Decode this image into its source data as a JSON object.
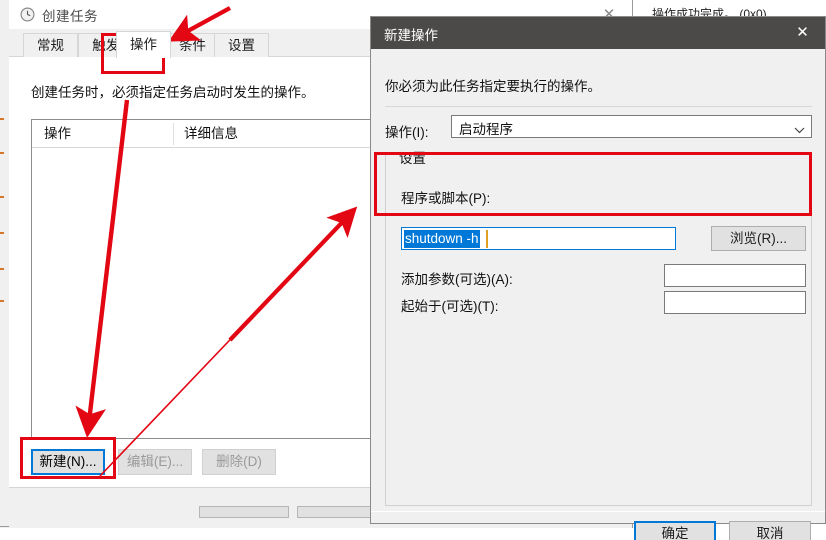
{
  "background_window": {
    "status_code": "0",
    "status_message": "操作成功完成。 (0x0)"
  },
  "main_window": {
    "title": "创建任务",
    "title_icon": "clock-icon",
    "close_label": "✕",
    "tabs": [
      {
        "label": "常规",
        "active": false
      },
      {
        "label": "触发器",
        "active": false
      },
      {
        "label": "操作",
        "active": true
      },
      {
        "label": "条件",
        "active": false
      },
      {
        "label": "设置",
        "active": false
      }
    ],
    "description": "创建任务时，必须指定任务启动时发生的操作。",
    "listview": {
      "columns": [
        "操作",
        "详细信息"
      ],
      "rows": []
    },
    "buttons": [
      {
        "label": "新建(N)...",
        "state": "focused"
      },
      {
        "label": "编辑(E)...",
        "state": "disabled"
      },
      {
        "label": "删除(D)",
        "state": "disabled"
      }
    ]
  },
  "dialog": {
    "title": "新建操作",
    "close_label": "✕",
    "description": "你必须为此任务指定要执行的操作。",
    "action": {
      "label": "操作(I):",
      "value": "启动程序",
      "chevron": "chevron-down-icon"
    },
    "settings_group": {
      "title": "设置",
      "program_label": "程序或脚本(P):",
      "program_value": "shutdown -h",
      "browse_label": "浏览(R)...",
      "args_label": "添加参数(可选)(A):",
      "args_value": "",
      "startin_label": "起始于(可选)(T):",
      "startin_value": ""
    },
    "buttons": {
      "ok": "确定",
      "cancel": "取消"
    }
  },
  "annotations": {
    "accent_color": "#e30613",
    "boxes": [
      {
        "name": "tab-highlight-box"
      },
      {
        "name": "new-button-box"
      },
      {
        "name": "program-field-box"
      }
    ],
    "arrows": [
      {
        "name": "arrow-to-tab"
      },
      {
        "name": "arrow-to-new-button"
      },
      {
        "name": "arrow-to-program-field"
      }
    ]
  }
}
